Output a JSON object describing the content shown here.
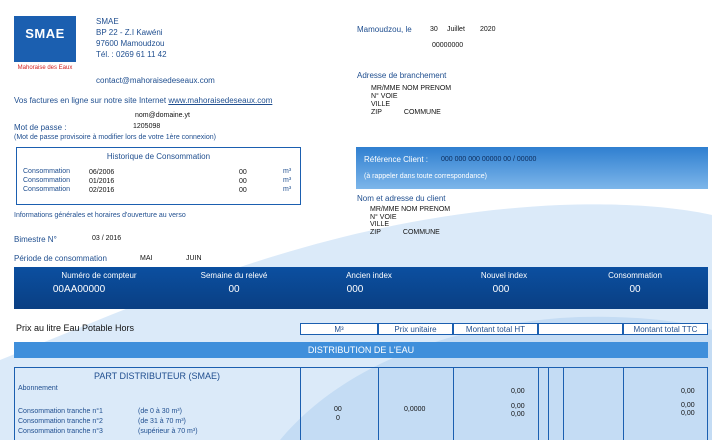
{
  "logo": {
    "text": "SMAE",
    "tagline": "Mahoraise des Eaux"
  },
  "company": {
    "name": "SMAE",
    "address1": "BP 22 - Z.I Kawéni",
    "address2": "97600 Mamoudzou",
    "phone": "Tél. : 0269 61 11 42",
    "email": "contact@mahoraisedeseaux.com"
  },
  "online": {
    "text": "Vos factures en ligne sur notre site Internet ",
    "url": "www.mahoraisedeseaux.com"
  },
  "login": {
    "email": "nom@domaine.yt",
    "password_label": "Mot de passe :",
    "password": "1205098",
    "note": "(Mot de passe provisoire à modifier lors de votre 1ère connexion)"
  },
  "history": {
    "title": "Historique de Consommation",
    "rows": [
      {
        "label": "Consommation",
        "period": "06/2006",
        "value": "00",
        "unit": "m³"
      },
      {
        "label": "Consommation",
        "period": "01/2016",
        "value": "00",
        "unit": "m³"
      },
      {
        "label": "Consommation",
        "period": "02/2016",
        "value": "00",
        "unit": "m³"
      }
    ]
  },
  "info_text": "Informations générales et horaires d'ouverture au verso",
  "bimestre": {
    "label": "Bimestre N°",
    "value": "03 / 2016"
  },
  "period": {
    "label": "Période de consommation",
    "from": "MAI",
    "to": "JUIN"
  },
  "date": {
    "place": "Mamoudzou, le",
    "day": "30",
    "month": "Juillet",
    "year": "2020",
    "number": "00000000"
  },
  "branchement": {
    "title": "Adresse de branchement",
    "line1": "MR/MME NOM PRENOM",
    "line2": "N° VOIE",
    "line3": "VILLE",
    "zip": "ZIP",
    "commune": "COMMUNE"
  },
  "client_ref": {
    "label": "Référence Client :",
    "value": "000 000 000 00000 00 / 00000",
    "note": "(à rappeler dans toute correspondance)"
  },
  "client_addr": {
    "title": "Nom et adresse du client",
    "line1": "MR/MME NOM PRENOM",
    "line2": "N° VOIE",
    "line3": "VILLE",
    "zip": "ZIP",
    "commune": "COMMUNE"
  },
  "meter": {
    "headers": [
      "Numéro de compteur",
      "Semaine du relevé",
      "Ancien index",
      "Nouvel index",
      "Consommation"
    ],
    "values": [
      "00AA00000",
      "00",
      "000",
      "000",
      "00"
    ]
  },
  "price_label": "Prix au litre Eau Potable Hors",
  "columns": {
    "m3": "M³",
    "unit_price": "Prix unitaire",
    "total_ht": "Montant total HT",
    "total_ttc": "Montant total TTC"
  },
  "distribution_title": "DISTRIBUTION DE L'EAU",
  "distributor": {
    "title": "PART DISTRIBUTEUR (SMAE)",
    "abonnement": "Abonnement",
    "abonnement_ht": "0,00",
    "abonnement_ttc": "0,00",
    "tranches": [
      {
        "label": "Consommation tranche n°1",
        "range": "(de 0 à 30 m³)"
      },
      {
        "label": "Consommation tranche n°2",
        "range": "(de 31 à 70 m³)"
      },
      {
        "label": "Consommation tranche n°3",
        "range": "(supérieur à 70 m³)"
      }
    ],
    "m3_values": [
      "00",
      "0"
    ],
    "unit_price": "0,0000",
    "ht_values": [
      "0,00",
      "0,00"
    ],
    "ttc_values": [
      "0,00",
      "0,00"
    ]
  }
}
